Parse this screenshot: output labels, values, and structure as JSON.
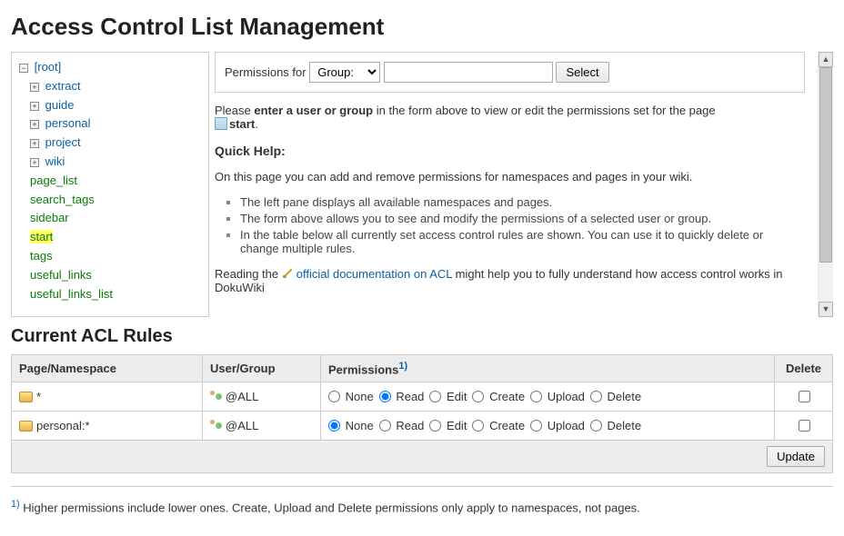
{
  "title": "Access Control List Management",
  "tree": {
    "root_label": "[root]",
    "namespaces": [
      "extract",
      "guide",
      "personal",
      "project",
      "wiki"
    ],
    "pages": [
      "page_list",
      "search_tags",
      "sidebar",
      "start",
      "tags",
      "useful_links",
      "useful_links_list"
    ],
    "selected_page": "start"
  },
  "form": {
    "label": "Permissions for",
    "scope_value": "Group:",
    "name_value": "",
    "select_btn": "Select"
  },
  "intro": {
    "please": "Please ",
    "bold": "enter a user or group",
    "rest": " in the form above to view or edit the permissions set for the page ",
    "page": "start",
    "period": "."
  },
  "help": {
    "heading": "Quick Help:",
    "p1": "On this page you can add and remove permissions for namespaces and pages in your wiki.",
    "b1": "The left pane displays all available namespaces and pages.",
    "b2": "The form above allows you to see and modify the permissions of a selected user or group.",
    "b3": "In the table below all currently set access control rules are shown. You can use it to quickly delete or change multiple rules.",
    "reading_pre": "Reading the ",
    "reading_link": "official documentation on ACL",
    "reading_post": " might help you to fully understand how access control works in DokuWiki"
  },
  "rules_heading": "Current ACL Rules",
  "table": {
    "h_page": "Page/Namespace",
    "h_user": "User/Group",
    "h_perm": "Permissions",
    "h_perm_foot": "1)",
    "h_del": "Delete",
    "perm_labels": [
      "None",
      "Read",
      "Edit",
      "Create",
      "Upload",
      "Delete"
    ],
    "rows": [
      {
        "page": "*",
        "user": "@ALL",
        "selected": "Read",
        "del": false
      },
      {
        "page": "personal:*",
        "user": "@ALL",
        "selected": "None",
        "del": false
      }
    ],
    "update_btn": "Update"
  },
  "footnote": {
    "ref": "1)",
    "text": " Higher permissions include lower ones. Create, Upload and Delete permissions only apply to namespaces, not pages."
  }
}
